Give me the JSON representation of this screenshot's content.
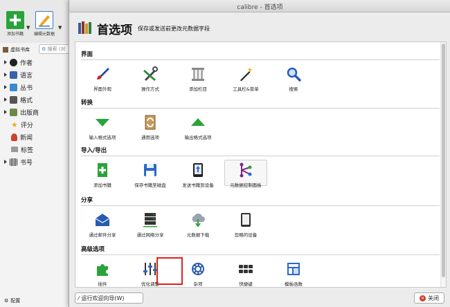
{
  "main_window": {
    "toolbar": {
      "add_book": "添加书籍",
      "edit_metadata": "编辑元数据"
    },
    "virtual_library": "虚拟书库",
    "search_placeholder": "搜索 (对",
    "tree": [
      "作者",
      "语言",
      "丛书",
      "格式",
      "出版商",
      "评分",
      "新闻",
      "标签",
      "书号"
    ],
    "configure": "配置"
  },
  "dialog": {
    "window_title": "calibre - 首选项",
    "header_title": "首选项",
    "header_subtitle": "保存或发送前更改元数据字段",
    "sections": [
      {
        "title": "界面",
        "items": [
          "界面外观",
          "操作方式",
          "添加栏目",
          "工具栏&菜单",
          "搜索"
        ]
      },
      {
        "title": "转换",
        "items": [
          "输入格式选项",
          "通用选项",
          "输出格式选项"
        ]
      },
      {
        "title": "导入/导出",
        "items": [
          "添加书籍",
          "保存书籍至磁盘",
          "发送书籍到设备",
          "元数据控制面板"
        ]
      },
      {
        "title": "分享",
        "items": [
          "通过邮件分享",
          "通过网络分享",
          "元数据下载",
          "忽略的设备"
        ]
      },
      {
        "title": "高级选项",
        "items": [
          "插件",
          "优化调整",
          "杂项",
          "快捷键",
          "模板函数"
        ]
      }
    ],
    "wizard_button": "运行欢迎向导(W)",
    "close_button": "关闭"
  },
  "colors": {
    "highlight_border": "#e0201a",
    "accent_blue": "#2a68c8",
    "accent_green": "#2aa33a"
  }
}
